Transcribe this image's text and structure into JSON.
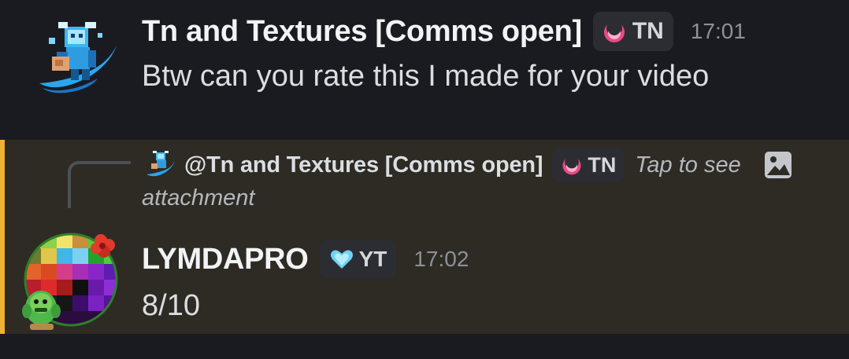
{
  "message_1": {
    "username": "Tn and Textures [Comms open]",
    "tag": "TN",
    "time": "17:01",
    "content": "Btw can you rate this I made for your video",
    "avatar_icon": "pixel-character-avatar"
  },
  "message_2": {
    "reply": {
      "mention": "@Tn and Textures [Comms open]",
      "tag": "TN",
      "preview_prefix": "Tap to see",
      "preview_suffix": "attachment",
      "attachment_icon": "image-icon"
    },
    "username": "LYMDAPRO",
    "tag": "YT",
    "time": "17:02",
    "content": "8/10",
    "avatar_icon": "pixel-pattern-avatar"
  },
  "colors": {
    "background": "#1a1b20",
    "mention_highlight": "#2d2b24",
    "mention_bar": "#f0b232",
    "tag_background": "#2c2d33",
    "timestamp": "#8e9097",
    "tn_tag_icon": "#e94b86",
    "yt_tag_icon": "#6fd3f5"
  }
}
